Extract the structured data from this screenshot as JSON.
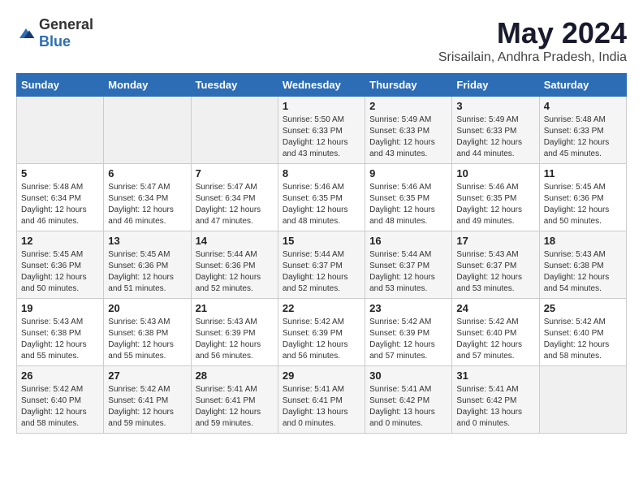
{
  "logo": {
    "general": "General",
    "blue": "Blue"
  },
  "title": "May 2024",
  "subtitle": "Srisailain, Andhra Pradesh, India",
  "days_header": [
    "Sunday",
    "Monday",
    "Tuesday",
    "Wednesday",
    "Thursday",
    "Friday",
    "Saturday"
  ],
  "weeks": [
    [
      {
        "day": "",
        "sunrise": "",
        "sunset": "",
        "daylight": ""
      },
      {
        "day": "",
        "sunrise": "",
        "sunset": "",
        "daylight": ""
      },
      {
        "day": "",
        "sunrise": "",
        "sunset": "",
        "daylight": ""
      },
      {
        "day": "1",
        "sunrise": "Sunrise: 5:50 AM",
        "sunset": "Sunset: 6:33 PM",
        "daylight": "Daylight: 12 hours and 43 minutes."
      },
      {
        "day": "2",
        "sunrise": "Sunrise: 5:49 AM",
        "sunset": "Sunset: 6:33 PM",
        "daylight": "Daylight: 12 hours and 43 minutes."
      },
      {
        "day": "3",
        "sunrise": "Sunrise: 5:49 AM",
        "sunset": "Sunset: 6:33 PM",
        "daylight": "Daylight: 12 hours and 44 minutes."
      },
      {
        "day": "4",
        "sunrise": "Sunrise: 5:48 AM",
        "sunset": "Sunset: 6:33 PM",
        "daylight": "Daylight: 12 hours and 45 minutes."
      }
    ],
    [
      {
        "day": "5",
        "sunrise": "Sunrise: 5:48 AM",
        "sunset": "Sunset: 6:34 PM",
        "daylight": "Daylight: 12 hours and 46 minutes."
      },
      {
        "day": "6",
        "sunrise": "Sunrise: 5:47 AM",
        "sunset": "Sunset: 6:34 PM",
        "daylight": "Daylight: 12 hours and 46 minutes."
      },
      {
        "day": "7",
        "sunrise": "Sunrise: 5:47 AM",
        "sunset": "Sunset: 6:34 PM",
        "daylight": "Daylight: 12 hours and 47 minutes."
      },
      {
        "day": "8",
        "sunrise": "Sunrise: 5:46 AM",
        "sunset": "Sunset: 6:35 PM",
        "daylight": "Daylight: 12 hours and 48 minutes."
      },
      {
        "day": "9",
        "sunrise": "Sunrise: 5:46 AM",
        "sunset": "Sunset: 6:35 PM",
        "daylight": "Daylight: 12 hours and 48 minutes."
      },
      {
        "day": "10",
        "sunrise": "Sunrise: 5:46 AM",
        "sunset": "Sunset: 6:35 PM",
        "daylight": "Daylight: 12 hours and 49 minutes."
      },
      {
        "day": "11",
        "sunrise": "Sunrise: 5:45 AM",
        "sunset": "Sunset: 6:36 PM",
        "daylight": "Daylight: 12 hours and 50 minutes."
      }
    ],
    [
      {
        "day": "12",
        "sunrise": "Sunrise: 5:45 AM",
        "sunset": "Sunset: 6:36 PM",
        "daylight": "Daylight: 12 hours and 50 minutes."
      },
      {
        "day": "13",
        "sunrise": "Sunrise: 5:45 AM",
        "sunset": "Sunset: 6:36 PM",
        "daylight": "Daylight: 12 hours and 51 minutes."
      },
      {
        "day": "14",
        "sunrise": "Sunrise: 5:44 AM",
        "sunset": "Sunset: 6:36 PM",
        "daylight": "Daylight: 12 hours and 52 minutes."
      },
      {
        "day": "15",
        "sunrise": "Sunrise: 5:44 AM",
        "sunset": "Sunset: 6:37 PM",
        "daylight": "Daylight: 12 hours and 52 minutes."
      },
      {
        "day": "16",
        "sunrise": "Sunrise: 5:44 AM",
        "sunset": "Sunset: 6:37 PM",
        "daylight": "Daylight: 12 hours and 53 minutes."
      },
      {
        "day": "17",
        "sunrise": "Sunrise: 5:43 AM",
        "sunset": "Sunset: 6:37 PM",
        "daylight": "Daylight: 12 hours and 53 minutes."
      },
      {
        "day": "18",
        "sunrise": "Sunrise: 5:43 AM",
        "sunset": "Sunset: 6:38 PM",
        "daylight": "Daylight: 12 hours and 54 minutes."
      }
    ],
    [
      {
        "day": "19",
        "sunrise": "Sunrise: 5:43 AM",
        "sunset": "Sunset: 6:38 PM",
        "daylight": "Daylight: 12 hours and 55 minutes."
      },
      {
        "day": "20",
        "sunrise": "Sunrise: 5:43 AM",
        "sunset": "Sunset: 6:38 PM",
        "daylight": "Daylight: 12 hours and 55 minutes."
      },
      {
        "day": "21",
        "sunrise": "Sunrise: 5:43 AM",
        "sunset": "Sunset: 6:39 PM",
        "daylight": "Daylight: 12 hours and 56 minutes."
      },
      {
        "day": "22",
        "sunrise": "Sunrise: 5:42 AM",
        "sunset": "Sunset: 6:39 PM",
        "daylight": "Daylight: 12 hours and 56 minutes."
      },
      {
        "day": "23",
        "sunrise": "Sunrise: 5:42 AM",
        "sunset": "Sunset: 6:39 PM",
        "daylight": "Daylight: 12 hours and 57 minutes."
      },
      {
        "day": "24",
        "sunrise": "Sunrise: 5:42 AM",
        "sunset": "Sunset: 6:40 PM",
        "daylight": "Daylight: 12 hours and 57 minutes."
      },
      {
        "day": "25",
        "sunrise": "Sunrise: 5:42 AM",
        "sunset": "Sunset: 6:40 PM",
        "daylight": "Daylight: 12 hours and 58 minutes."
      }
    ],
    [
      {
        "day": "26",
        "sunrise": "Sunrise: 5:42 AM",
        "sunset": "Sunset: 6:40 PM",
        "daylight": "Daylight: 12 hours and 58 minutes."
      },
      {
        "day": "27",
        "sunrise": "Sunrise: 5:42 AM",
        "sunset": "Sunset: 6:41 PM",
        "daylight": "Daylight: 12 hours and 59 minutes."
      },
      {
        "day": "28",
        "sunrise": "Sunrise: 5:41 AM",
        "sunset": "Sunset: 6:41 PM",
        "daylight": "Daylight: 12 hours and 59 minutes."
      },
      {
        "day": "29",
        "sunrise": "Sunrise: 5:41 AM",
        "sunset": "Sunset: 6:41 PM",
        "daylight": "Daylight: 13 hours and 0 minutes."
      },
      {
        "day": "30",
        "sunrise": "Sunrise: 5:41 AM",
        "sunset": "Sunset: 6:42 PM",
        "daylight": "Daylight: 13 hours and 0 minutes."
      },
      {
        "day": "31",
        "sunrise": "Sunrise: 5:41 AM",
        "sunset": "Sunset: 6:42 PM",
        "daylight": "Daylight: 13 hours and 0 minutes."
      },
      {
        "day": "",
        "sunrise": "",
        "sunset": "",
        "daylight": ""
      }
    ]
  ]
}
